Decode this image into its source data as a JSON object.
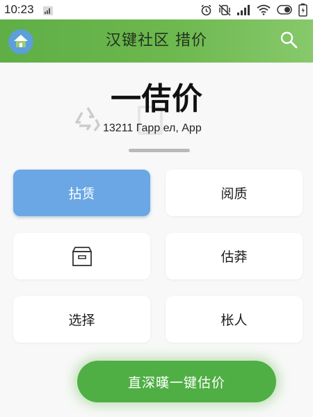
{
  "status_bar": {
    "time": "10:23"
  },
  "app_bar": {
    "title": "汉键社区 措价"
  },
  "hero": {
    "title": "一佶价",
    "subtitle": "13211 Гарр ел, Арр"
  },
  "options": [
    {
      "label": "拈赁",
      "selected": true
    },
    {
      "label": "阅质",
      "selected": false
    },
    {
      "label": "",
      "icon": "box-icon",
      "selected": false
    },
    {
      "label": "估莽",
      "selected": false
    },
    {
      "label": "选择",
      "selected": false
    },
    {
      "label": "枨人",
      "selected": false
    }
  ],
  "cta": {
    "label": "直深暵一键估价"
  },
  "colors": {
    "app_bar_green": "#6db84f",
    "selected_blue": "#6aa7e4",
    "cta_green": "#4faf45",
    "home_blue": "#5c9fd9"
  }
}
